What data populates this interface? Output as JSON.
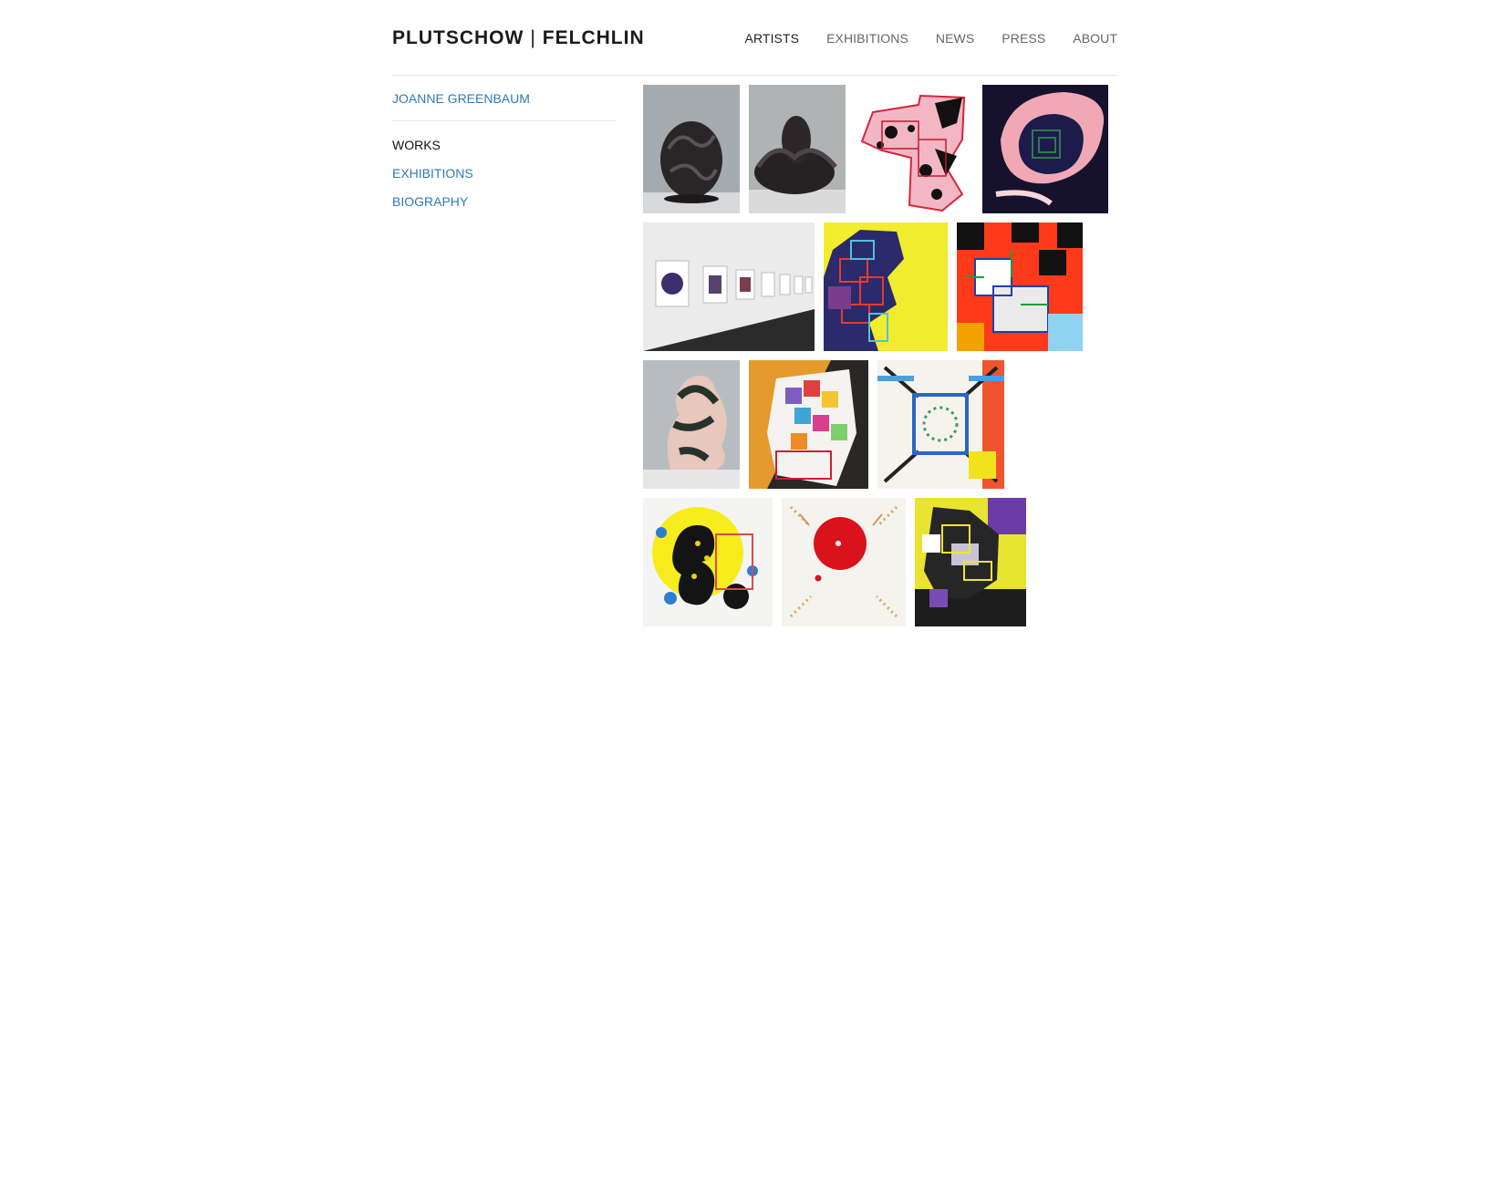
{
  "site": {
    "logo_left": "PLUTSCHOW",
    "logo_sep": "|",
    "logo_right": "FELCHLIN"
  },
  "nav": {
    "items": [
      "ARTISTS",
      "EXHIBITIONS",
      "NEWS",
      "PRESS",
      "ABOUT"
    ],
    "active": "ARTISTS"
  },
  "artist": {
    "name": "JOANNE GREENBAUM",
    "menu": [
      "WORKS",
      "EXHIBITIONS",
      "BIOGRAPHY"
    ],
    "current": "WORKS"
  },
  "colors": {
    "link": "#2e7bb5",
    "nav": "#666666",
    "divider": "#e6e6e6"
  },
  "works": [
    {
      "name": "work-sculpture-dark-1"
    },
    {
      "name": "work-sculpture-dark-2"
    },
    {
      "name": "work-pink-black-drawing"
    },
    {
      "name": "work-pink-swirl-dark"
    },
    {
      "name": "work-installation-view"
    },
    {
      "name": "work-yellow-grid-painting"
    },
    {
      "name": "work-red-black-grid-painting"
    },
    {
      "name": "work-sculpture-pink"
    },
    {
      "name": "work-colorful-squares-paper"
    },
    {
      "name": "work-blue-frame-drawing"
    },
    {
      "name": "work-yellow-circle-painting"
    },
    {
      "name": "work-red-dot-drawing"
    },
    {
      "name": "work-purple-yellow-painting"
    }
  ]
}
